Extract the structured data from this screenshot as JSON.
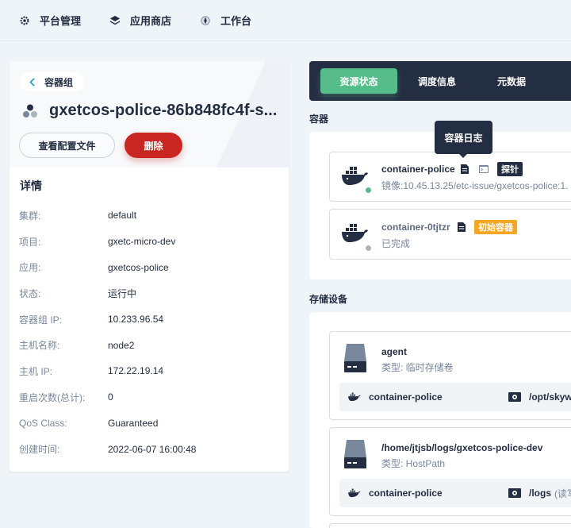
{
  "nav": {
    "items": [
      {
        "label": "平台管理",
        "icon": "gear-icon"
      },
      {
        "label": "应用商店",
        "icon": "app-store-icon"
      },
      {
        "label": "工作台",
        "icon": "workbench-icon"
      }
    ]
  },
  "pod": {
    "breadcrumb": "容器组",
    "name": "gxetcos-police-86b848fc4f-s...",
    "view_config_label": "查看配置文件",
    "delete_label": "删除"
  },
  "details": {
    "title": "详情",
    "rows": [
      {
        "key": "集群:",
        "value": "default"
      },
      {
        "key": "项目:",
        "value": "gxetc-micro-dev"
      },
      {
        "key": "应用:",
        "value": "gxetcos-police"
      },
      {
        "key": "状态:",
        "value": "运行中"
      },
      {
        "key": "容器组 IP:",
        "value": "10.233.96.54"
      },
      {
        "key": "主机名称:",
        "value": "node2"
      },
      {
        "key": "主机 IP:",
        "value": "172.22.19.14"
      },
      {
        "key": "重启次数(总计):",
        "value": "0"
      },
      {
        "key": "QoS Class:",
        "value": "Guaranteed"
      },
      {
        "key": "创建时间:",
        "value": "2022-06-07 16:00:48"
      }
    ]
  },
  "tabs": [
    {
      "label": "资源状态",
      "active": true
    },
    {
      "label": "调度信息",
      "active": false
    },
    {
      "label": "元数据",
      "active": false
    }
  ],
  "containers": {
    "section_label": "容器",
    "tooltip": "容器日志",
    "items": [
      {
        "name": "container-police",
        "tag": "探针",
        "tag_color": "#242e42",
        "sub": "镜像:10.45.13.25/etc-issue/gxetcos-police:1.",
        "status_color": "#55bc8a"
      },
      {
        "name": "container-0tjtzr",
        "tag": "初始容器",
        "tag_color": "#f5a623",
        "sub": "已完成",
        "status_color": "#abb4be"
      }
    ]
  },
  "storage": {
    "section_label": "存储设备",
    "volumes": [
      {
        "name": "agent",
        "type": "类型: 临时存储卷",
        "mount_container": "container-police",
        "mount_path": "/opt/skyw"
      },
      {
        "name": "/home/jtjsb/logs/gxetcos-police-dev",
        "type": "类型: HostPath",
        "mount_container": "container-police",
        "mount_path": "/logs",
        "mount_mode": "(读写"
      }
    ]
  }
}
